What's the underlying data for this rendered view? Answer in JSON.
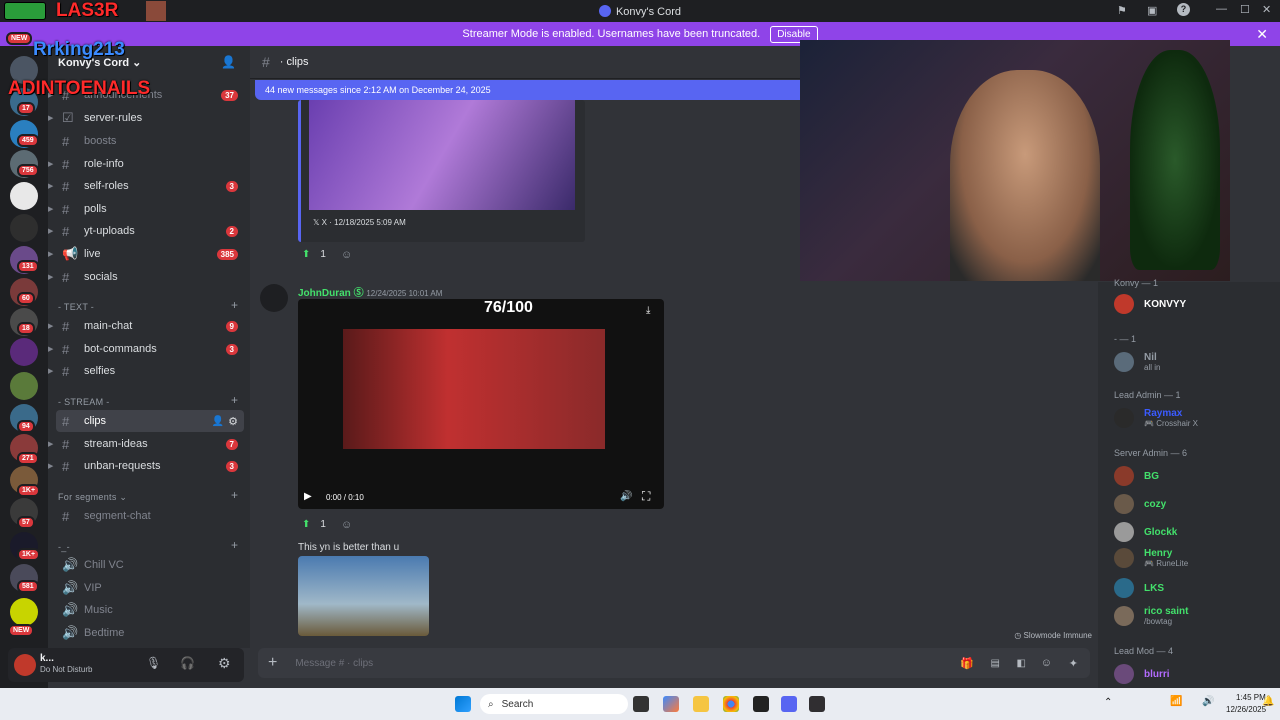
{
  "window": {
    "title": "Konvy's Cord"
  },
  "overlay": {
    "name1": "LAS3R",
    "name2": "Rrking213",
    "name3": "ADINTOENAILS"
  },
  "banner": {
    "text": "Streamer Mode is enabled. Usernames have been truncated.",
    "button": "Disable"
  },
  "server": {
    "name": "Konvy's Cord"
  },
  "servers": {
    "badges": [
      "NEW",
      "17",
      "459",
      "756",
      "131",
      "60",
      "18",
      "94",
      "271",
      "1K+",
      "57",
      "1K+",
      "581",
      "NEW"
    ]
  },
  "channels": {
    "top": [
      {
        "label": "announcements",
        "badge": "37"
      },
      {
        "label": "server-rules",
        "badge": ""
      },
      {
        "label": "boosts",
        "badge": ""
      },
      {
        "label": "role-info",
        "badge": ""
      },
      {
        "label": "self-roles",
        "badge": "3"
      },
      {
        "label": "polls",
        "badge": ""
      },
      {
        "label": "yt-uploads",
        "badge": "2"
      },
      {
        "label": "live",
        "badge": "385"
      },
      {
        "label": "socials",
        "badge": ""
      }
    ],
    "text_cat": "- TEXT -",
    "text": [
      {
        "label": "main-chat",
        "badge": "9"
      },
      {
        "label": "bot-commands",
        "badge": "3"
      },
      {
        "label": "selfies",
        "badge": ""
      }
    ],
    "stream_cat": "- STREAM -",
    "stream": [
      {
        "label": "clips",
        "badge": ""
      },
      {
        "label": "stream-ideas",
        "badge": "7"
      },
      {
        "label": "unban-requests",
        "badge": "3"
      }
    ],
    "segments_cat": "For segments",
    "segments": [
      {
        "label": "segment-chat"
      }
    ],
    "voice_cat": "-_-",
    "voice": [
      {
        "label": "Chill VC"
      },
      {
        "label": "VIP"
      },
      {
        "label": "Music"
      },
      {
        "label": "Bedtime"
      }
    ]
  },
  "user": {
    "name": "k...",
    "status": "Do Not Disturb"
  },
  "chat": {
    "channel": "clips",
    "new_messages": "44 new messages since 2:12 AM on December 24, 2025",
    "embed1": {
      "source": "X",
      "date": "12/18/2025 5:09 AM",
      "reaction_count": "1"
    },
    "message2": {
      "author": "JohnDuran",
      "time": "12/24/2025 10:01 AM",
      "video_overlay": "76/100",
      "video_time": "0:00 / 0:10",
      "reaction_count": "1"
    },
    "message3": {
      "text": "This yn is better than u"
    },
    "slowmode": "Slowmode Immune",
    "input_placeholder": "Message # · clips"
  },
  "members": {
    "groups": [
      {
        "title": "Konvy — 1",
        "members": [
          {
            "name": "KONVYY",
            "sub": "",
            "color": "#ffffff"
          }
        ]
      },
      {
        "title": "- — 1",
        "members": [
          {
            "name": "Nil",
            "sub": "all in",
            "color": "#949ba4"
          }
        ]
      },
      {
        "title": "Lead Admin — 1",
        "members": [
          {
            "name": "Raymax",
            "sub": "Crosshair X",
            "color": "#3b5bff"
          }
        ]
      },
      {
        "title": "Server Admin — 6",
        "members": [
          {
            "name": "BG",
            "sub": "",
            "color": "#43e06b"
          },
          {
            "name": "cozy",
            "sub": "",
            "color": "#43e06b"
          },
          {
            "name": "Glockk",
            "sub": "",
            "color": "#43e06b"
          },
          {
            "name": "Henry",
            "sub": "RuneLite",
            "color": "#43e06b"
          },
          {
            "name": "LKS",
            "sub": "",
            "color": "#43e06b"
          },
          {
            "name": "rico saint",
            "sub": "/bowtag",
            "color": "#43e06b"
          }
        ]
      },
      {
        "title": "Lead Mod — 4",
        "members": [
          {
            "name": "blurri",
            "sub": "",
            "color": "#b36bff"
          }
        ]
      }
    ]
  },
  "taskbar": {
    "search": "Search",
    "time": "1:45 PM",
    "date": "12/26/2025"
  }
}
